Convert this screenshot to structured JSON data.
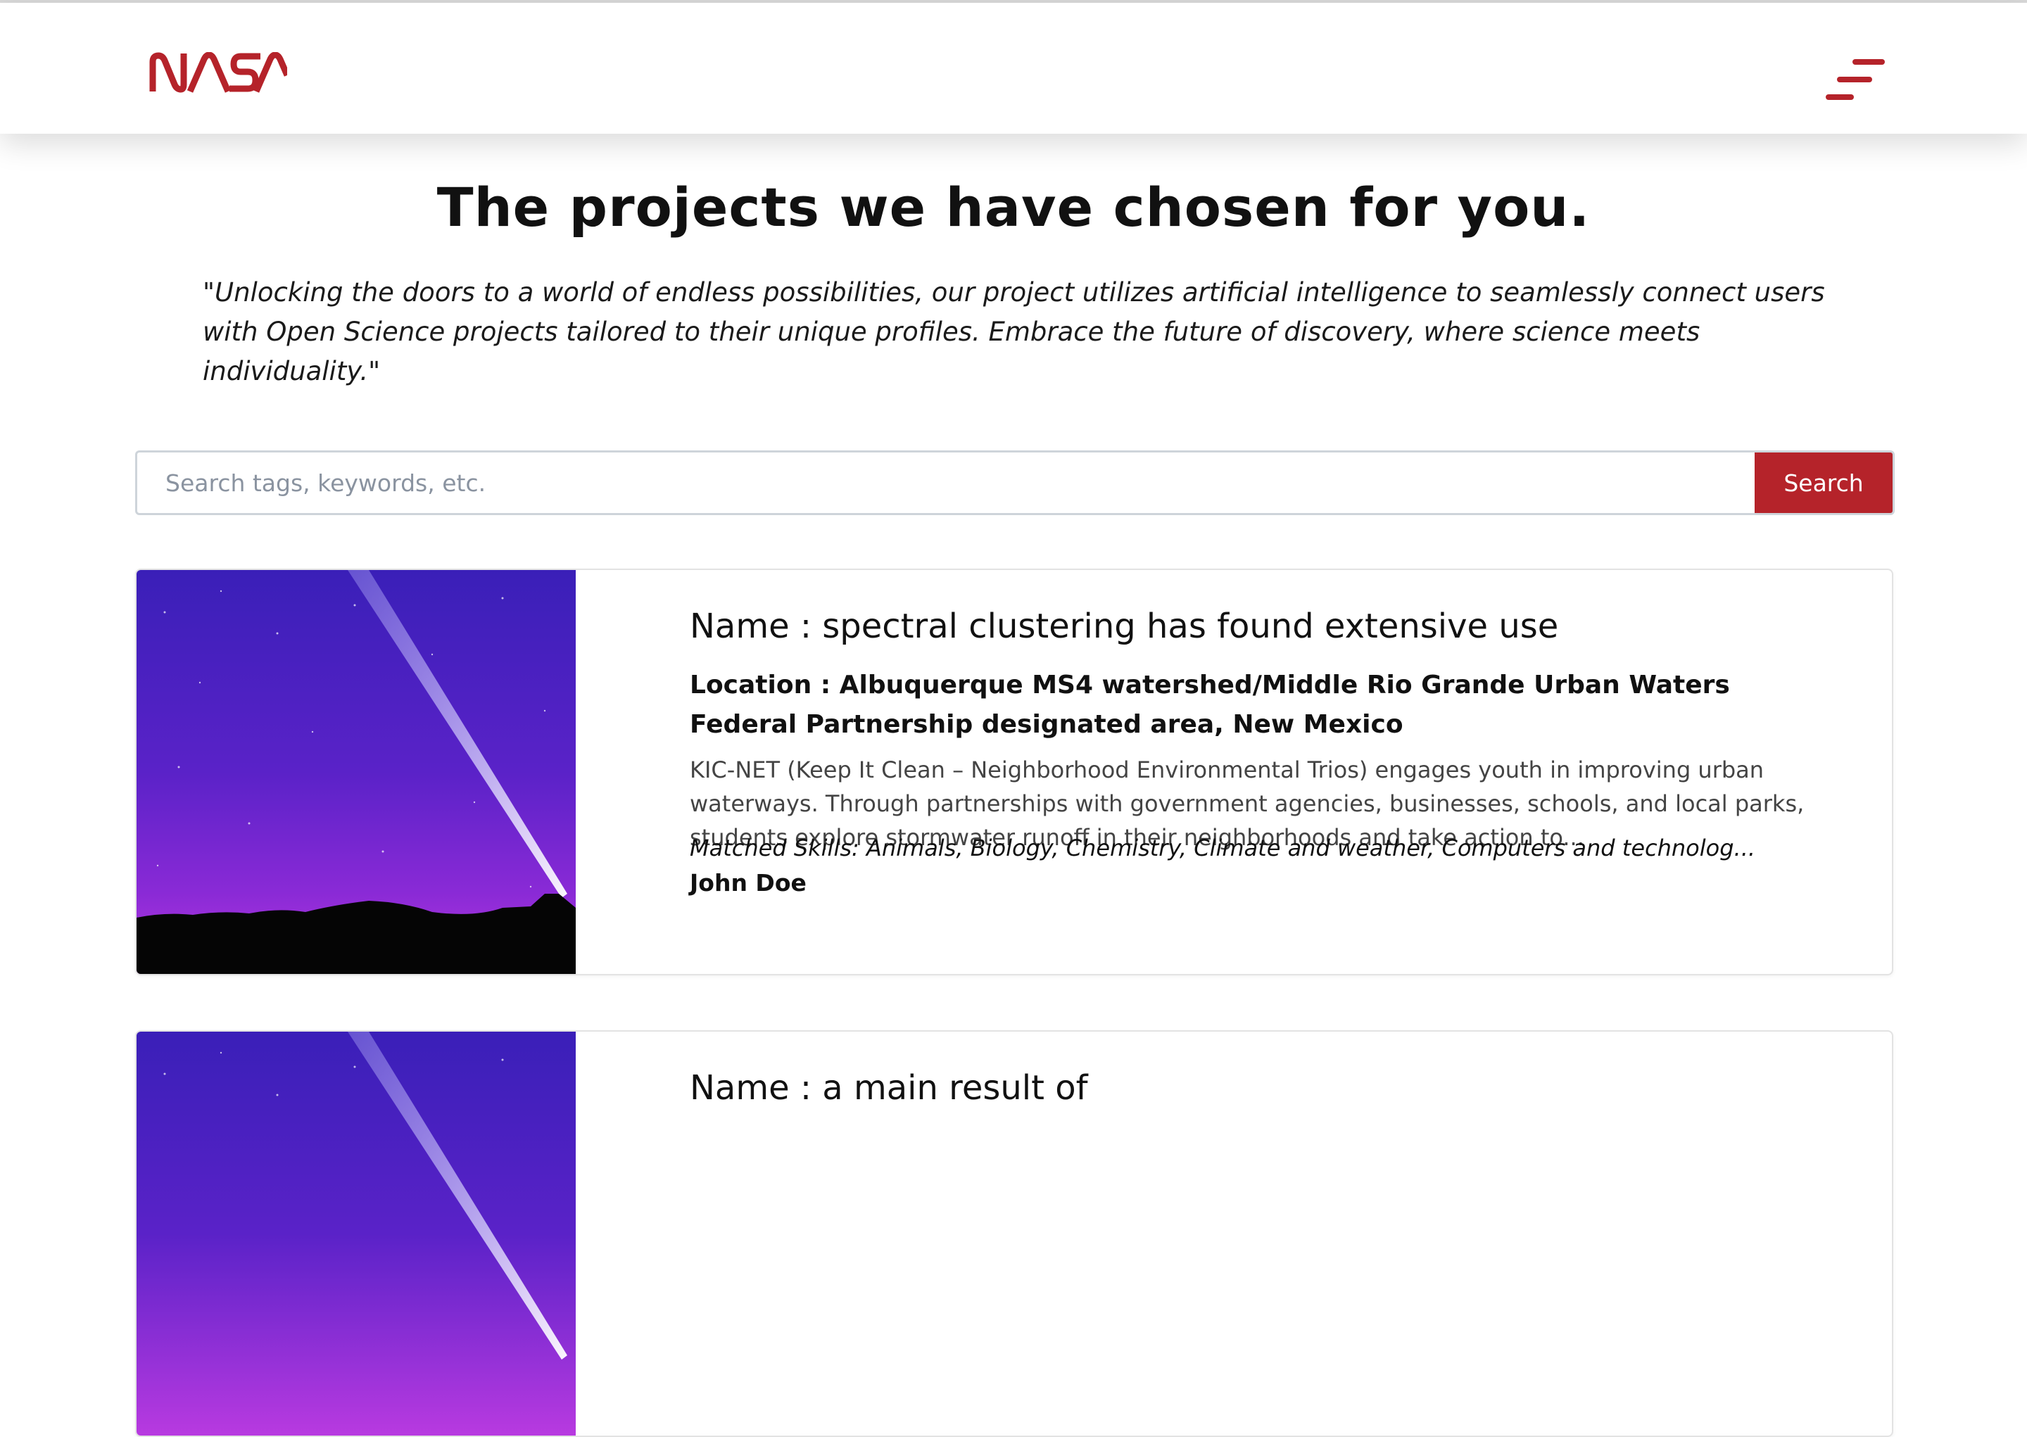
{
  "header": {
    "logo_text": "NASA",
    "brand_color": "#b5232a"
  },
  "main": {
    "title": "The projects we have chosen for you.",
    "quote": "\"Unlocking the doors to a world of endless possibilities, our project utilizes artificial intelligence to seamlessly connect users with Open Science projects tailored to their unique profiles. Embrace the future of discovery, where science meets individuality.\""
  },
  "search": {
    "placeholder": "Search tags, keywords, etc.",
    "value": "",
    "button_label": "Search"
  },
  "projects": [
    {
      "name": "Name : spectral clustering has found extensive use",
      "location": "Location : Albuquerque MS4 watershed/Middle Rio Grande Urban Waters Federal Partnership designated area, New Mexico",
      "description": "KIC-NET (Keep It Clean – Neighborhood Environmental Trios) engages youth in improving urban waterways. Through partnerships with government agencies, businesses, schools, and local parks, students explore stormwater runoff in their neighborhoods and take action to...",
      "skills": "Matched Skills: Animals, Biology, Chemistry, Climate and weather, Computers and technolog...",
      "author": "John Doe"
    },
    {
      "name": "Name : a main result of"
    }
  ]
}
